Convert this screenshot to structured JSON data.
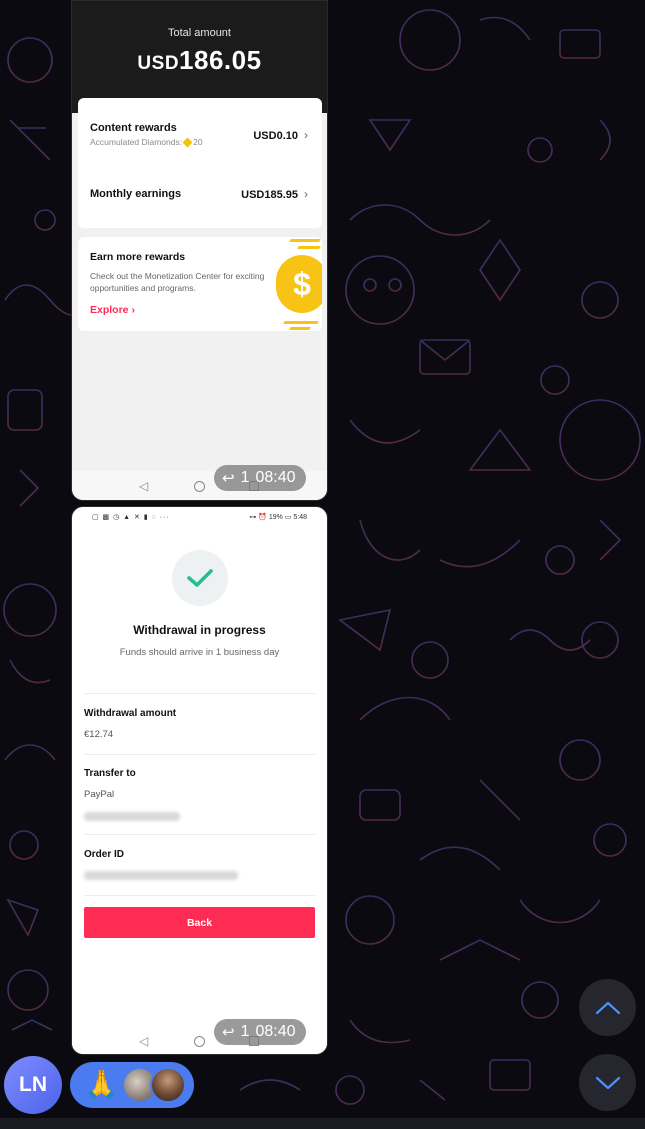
{
  "earnings": {
    "total_label": "Total amount",
    "total_currency": "USD",
    "total_amount": "186.05",
    "content_rewards": {
      "label": "Content rewards",
      "sub_label": "Accumulated Diamonds:",
      "diamonds": "20",
      "value": "USD0.10"
    },
    "monthly_earnings": {
      "label": "Monthly earnings",
      "value": "USD185.95"
    },
    "promo": {
      "title": "Earn more rewards",
      "description": "Check out the Monetization Center for exciting opportunities and programs.",
      "link": "Explore"
    },
    "time": "08:40",
    "reply_count": "1"
  },
  "withdrawal": {
    "status_bar": {
      "left_icons": "▢ ▩ ◷ ▲ ✕ ▮ ◌ ···",
      "right_text": "⊶ ⏰ 19% ▭ 5:48"
    },
    "title": "Withdrawal in progress",
    "subtitle": "Funds should arrive in 1 business day",
    "amount_label": "Withdrawal amount",
    "amount_value": "€12.74",
    "transfer_label": "Transfer to",
    "transfer_value": "PayPal",
    "order_label": "Order ID",
    "back_label": "Back",
    "time": "08:40",
    "reply_count": "1"
  },
  "chat": {
    "avatar_initials": "LN",
    "reaction_emoji": "🙏"
  },
  "colors": {
    "accent_red": "#fe2c55",
    "check_green": "#1fbf8f",
    "coin_yellow": "#f7c415",
    "avatar_blue": "#5a72f0",
    "reaction_blue": "#4a7cf0",
    "scroll_arrow": "#4a90ff"
  },
  "icons": [
    "back-triangle-icon",
    "home-circle-icon",
    "recent-square-icon",
    "reply-arrow-icon",
    "check-icon",
    "chevron-right-icon",
    "chevron-up-icon",
    "chevron-down-icon",
    "diamond-icon",
    "dollar-coin-icon"
  ]
}
